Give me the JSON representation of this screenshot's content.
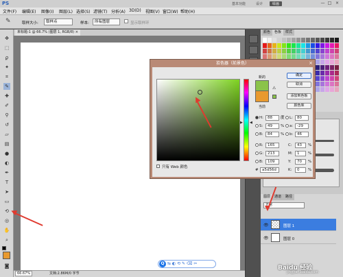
{
  "app": {
    "logo": "PS",
    "workspace_labels": [
      "基本功能",
      "设计",
      "绘画"
    ],
    "window_buttons": [
      "—",
      "□",
      "×"
    ]
  },
  "menu": [
    "文件(F)",
    "编辑(E)",
    "图像(I)",
    "图层(L)",
    "选择(S)",
    "滤镜(T)",
    "分析(A)",
    "3D(D)",
    "视图(V)",
    "窗口(W)",
    "帮助(H)"
  ],
  "options": {
    "size_label": "取样大小:",
    "size_value": "取样点",
    "sample_label": "样本:",
    "sample_value": "所有图层",
    "ring_label": "显示取样环"
  },
  "document": {
    "tab_label": "未标题-1 @ 66.7% (图层 1, RGB/8) ×",
    "zoom": "66.67%",
    "status": "文档:2.86M/0 字节"
  },
  "panels": {
    "swatches_tabs": [
      "颜色",
      "色板",
      "样式"
    ],
    "layers_tabs": [
      "图层",
      "通道",
      "路径"
    ],
    "blend_mode": "正常",
    "layers": [
      {
        "name": "图层 1",
        "selected": true
      },
      {
        "name": "图层 0",
        "selected": false
      }
    ]
  },
  "picker": {
    "title": "拾色器（前景色）",
    "new_label": "新的",
    "current_label": "当前",
    "buttons": [
      "确定",
      "取消",
      "添加到色板",
      "颜色库"
    ],
    "hsb": [
      {
        "label": "H:",
        "value": "88",
        "unit": "度",
        "selected": true
      },
      {
        "label": "S:",
        "value": "49",
        "unit": "%",
        "selected": false
      },
      {
        "label": "B:",
        "value": "84",
        "unit": "%",
        "selected": false
      }
    ],
    "rgb": [
      {
        "label": "R:",
        "value": "165"
      },
      {
        "label": "G:",
        "value": "213"
      },
      {
        "label": "B:",
        "value": "109"
      }
    ],
    "lab": [
      {
        "label": "L:",
        "value": "80"
      },
      {
        "label": "a:",
        "value": "-29"
      },
      {
        "label": "b:",
        "value": "46"
      }
    ],
    "cmyk": [
      {
        "label": "C:",
        "value": "43",
        "unit": "%"
      },
      {
        "label": "M:",
        "value": "1",
        "unit": "%"
      },
      {
        "label": "Y:",
        "value": "70",
        "unit": "%"
      },
      {
        "label": "K:",
        "value": "0",
        "unit": "%"
      }
    ],
    "hex_label": "#",
    "hex_value": "a5d56d",
    "web_only_label": "只有 Web 颜色"
  },
  "colors": {
    "foreground": "#e8992e",
    "new_color": "#8bc34a",
    "accent": "#e03a2f"
  },
  "floatbar": {
    "logo": "Q"
  },
  "watermark": {
    "main": "Baidu 经验",
    "sub": "jingyan.baidu.com"
  }
}
